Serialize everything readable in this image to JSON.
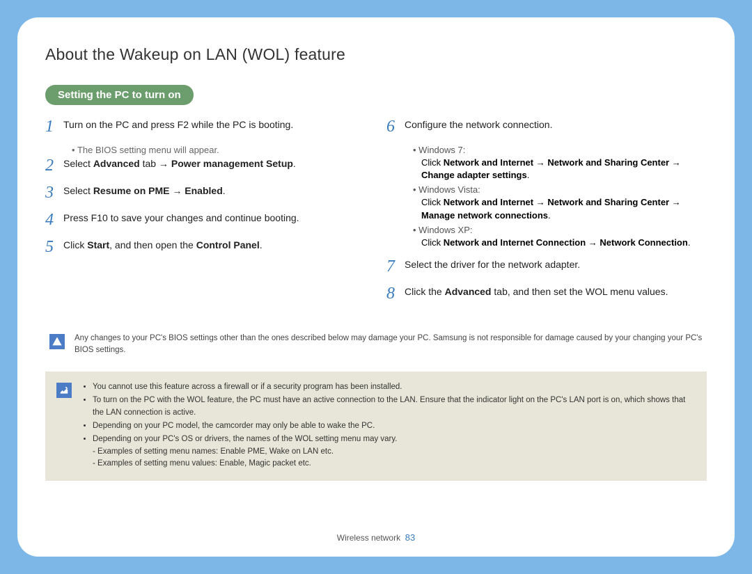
{
  "title": "About the Wakeup on LAN (WOL) feature",
  "section_pill": "Setting the PC to turn on",
  "steps_left": [
    {
      "n": "1",
      "html": "Turn on the PC and press F2 while the PC is booting.",
      "sub": "The BIOS setting menu will appear."
    },
    {
      "n": "2",
      "html": "Select <b>Advanced</b> tab → <b>Power management Setup</b>."
    },
    {
      "n": "3",
      "html": "Select <b>Resume on PME</b> → <b>Enabled</b>."
    },
    {
      "n": "4",
      "html": "Press F10 to save your changes and continue booting."
    },
    {
      "n": "5",
      "html": "Click <b>Start</b>, and then open the <b>Control Panel</b>."
    }
  ],
  "step6": {
    "n": "6",
    "text": "Configure the network connection.",
    "os": [
      {
        "name": "Windows 7:",
        "detail": "Click <b>Network and Internet</b> → <b>Network and Sharing Center</b> → <b>Change adapter settings</b>."
      },
      {
        "name": "Windows Vista:",
        "detail": "Click <b>Network and Internet</b> → <b>Network and Sharing Center</b> → <b>Manage network connections</b>."
      },
      {
        "name": "Windows XP:",
        "detail": "Click <b>Network and Internet Connection</b> → <b>Network Connection</b>."
      }
    ]
  },
  "steps_right_rest": [
    {
      "n": "7",
      "html": "Select the driver for the network adapter."
    },
    {
      "n": "8",
      "html": "Click the <b>Advanced</b> tab, and then set the WOL menu values."
    }
  ],
  "warning": "Any changes to your PC's BIOS settings other than the ones described below may damage your PC. Samsung is not responsible for damage caused by your changing your PC's BIOS settings.",
  "notes": [
    "You cannot use this feature across a firewall or if a security program has been installed.",
    "To turn on the PC with the WOL feature, the PC must have an active connection to the LAN. Ensure that the indicator light on the PC's LAN port is on, which shows that the LAN connection is active.",
    "Depending on your PC model, the camcorder may only be able to wake the PC.",
    "Depending on your PC's OS or drivers, the names of the WOL setting menu may vary."
  ],
  "note_subs": [
    "- Examples of setting menu names: Enable PME, Wake on LAN etc.",
    "- Examples of setting menu values: Enable, Magic packet etc."
  ],
  "footer_section": "Wireless network",
  "page_number": "83"
}
